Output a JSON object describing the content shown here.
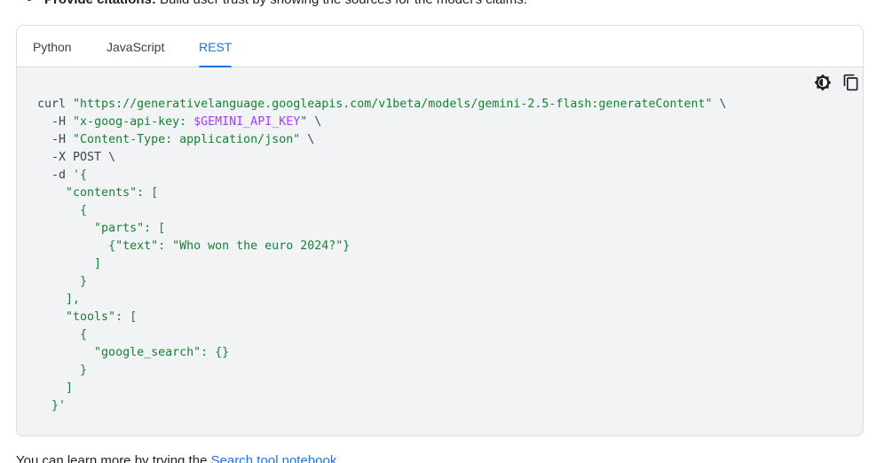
{
  "top_bullet": {
    "bold": "Provide citations:",
    "rest": " Build user trust by showing the sources for the model's claims."
  },
  "tabs": [
    {
      "label": "Python",
      "active": false
    },
    {
      "label": "JavaScript",
      "active": false
    },
    {
      "label": "REST",
      "active": true
    }
  ],
  "toolbar": {
    "theme_icon": "brightness-icon",
    "copy_icon": "copy-icon"
  },
  "code_lines": [
    {
      "indent": "",
      "parts": [
        {
          "t": "plain",
          "v": "curl "
        },
        {
          "t": "str",
          "v": "\"https://generativelanguage.googleapis.com/v1beta/models/gemini-2.5-flash:generateContent\""
        },
        {
          "t": "plain",
          "v": " \\"
        }
      ]
    },
    {
      "indent": "  ",
      "parts": [
        {
          "t": "plain",
          "v": "-H "
        },
        {
          "t": "str",
          "v": "\"x-goog-api-key: "
        },
        {
          "t": "var",
          "v": "$GEMINI_API_KEY"
        },
        {
          "t": "str",
          "v": "\""
        },
        {
          "t": "plain",
          "v": " \\"
        }
      ]
    },
    {
      "indent": "  ",
      "parts": [
        {
          "t": "plain",
          "v": "-H "
        },
        {
          "t": "str",
          "v": "\"Content-Type: application/json\""
        },
        {
          "t": "plain",
          "v": " \\"
        }
      ]
    },
    {
      "indent": "  ",
      "parts": [
        {
          "t": "plain",
          "v": "-X POST \\"
        }
      ]
    },
    {
      "indent": "  ",
      "parts": [
        {
          "t": "plain",
          "v": "-d "
        },
        {
          "t": "str",
          "v": "'{"
        }
      ]
    },
    {
      "indent": "    ",
      "parts": [
        {
          "t": "str",
          "v": "\"contents\": ["
        }
      ]
    },
    {
      "indent": "      ",
      "parts": [
        {
          "t": "str",
          "v": "{"
        }
      ]
    },
    {
      "indent": "        ",
      "parts": [
        {
          "t": "str",
          "v": "\"parts\": ["
        }
      ]
    },
    {
      "indent": "          ",
      "parts": [
        {
          "t": "str",
          "v": "{\"text\": \"Who won the euro 2024?\"}"
        }
      ]
    },
    {
      "indent": "        ",
      "parts": [
        {
          "t": "str",
          "v": "]"
        }
      ]
    },
    {
      "indent": "      ",
      "parts": [
        {
          "t": "str",
          "v": "}"
        }
      ]
    },
    {
      "indent": "    ",
      "parts": [
        {
          "t": "str",
          "v": "],"
        }
      ]
    },
    {
      "indent": "    ",
      "parts": [
        {
          "t": "str",
          "v": "\"tools\": ["
        }
      ]
    },
    {
      "indent": "      ",
      "parts": [
        {
          "t": "str",
          "v": "{"
        }
      ]
    },
    {
      "indent": "        ",
      "parts": [
        {
          "t": "str",
          "v": "\"google_search\": {}"
        }
      ]
    },
    {
      "indent": "      ",
      "parts": [
        {
          "t": "str",
          "v": "}"
        }
      ]
    },
    {
      "indent": "    ",
      "parts": [
        {
          "t": "str",
          "v": "]"
        }
      ]
    },
    {
      "indent": "  ",
      "parts": [
        {
          "t": "str",
          "v": "}'"
        }
      ]
    }
  ],
  "bottom": {
    "prefix": "You can learn more by trying the ",
    "link": "Search tool notebook",
    "suffix": "."
  },
  "colors": {
    "accent": "#1a73e8",
    "code_string": "#188038",
    "code_variable": "#a142f4",
    "code_plain": "#37474f",
    "code_background": "#f1f3f4"
  }
}
